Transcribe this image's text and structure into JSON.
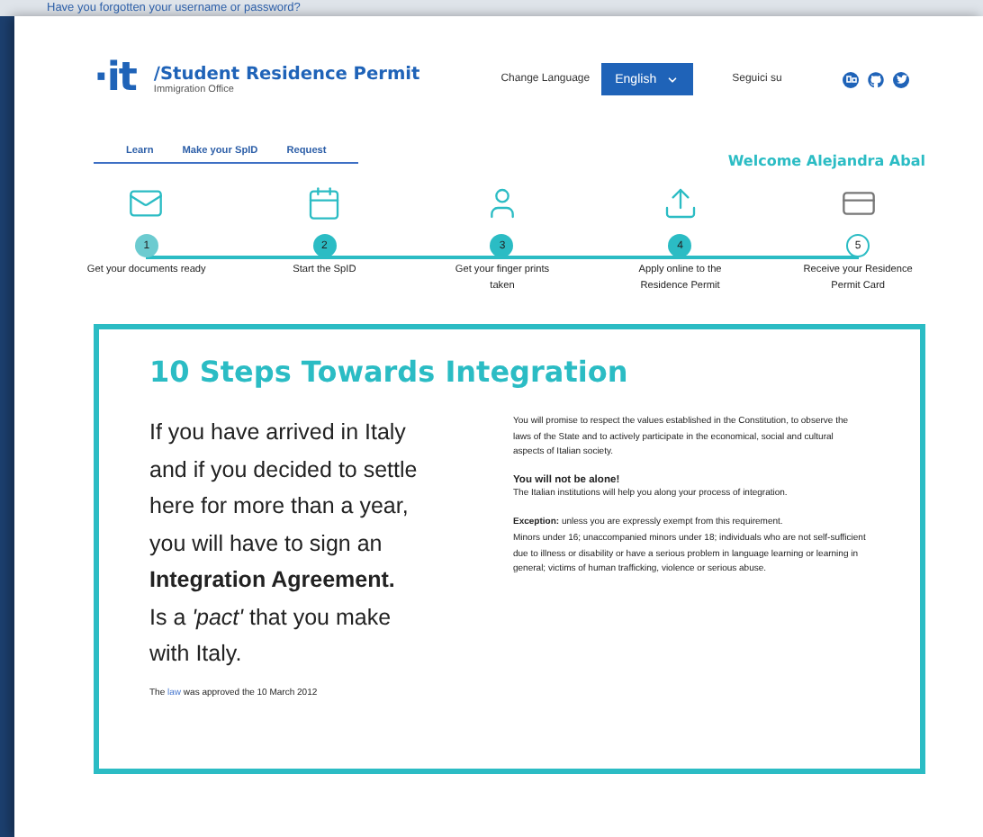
{
  "backdrop": {
    "forgot_link": "Have you forgotten your username or password?"
  },
  "header": {
    "logo": "·it",
    "title": "/Student Residence Permit",
    "subtitle": "Immigration Office",
    "language_label": "Change Language",
    "language": "English",
    "follow_label": "Seguici su"
  },
  "nav": {
    "tabs": [
      {
        "label": "Learn"
      },
      {
        "label": "Make your SpID"
      },
      {
        "label": "Request"
      }
    ],
    "welcome": "Welcome Alejandra Abal"
  },
  "steps": [
    {
      "number": "1",
      "label": "Get your documents ready",
      "kind": "pale"
    },
    {
      "number": "2",
      "label": "Start the SpID",
      "kind": "filled"
    },
    {
      "number": "3",
      "label": "Get your finger prints taken",
      "kind": "filled"
    },
    {
      "number": "4",
      "label": "Apply online to the Residence Permit",
      "kind": "filled"
    },
    {
      "number": "5",
      "label": "Receive your Residence Permit Card",
      "kind": "outline"
    }
  ],
  "info": {
    "title": "10 Steps Towards Integration",
    "lead_lines": [
      "If you have arrived in Italy",
      "and if you decided to settle",
      "here for more than a year,",
      "you will have to sign an",
      "**Integration Agreement.**",
      "Is a *'pact'* that you make",
      "with Italy."
    ],
    "note": {
      "before": "The",
      "link": "law",
      "after": "was approved the 10 March 2012"
    },
    "paragraph_1": "You will promise to respect the values established in the Constitution, to observe the laws of the State and to actively participate in the economical, social and cultural aspects of Italian society.",
    "subheading": "You will not be alone!",
    "paragraph_2": "The Italian institutions will help you along your process of integration.",
    "paragraph_3": "**Exception:** unless you are expressly exempt from this requirement.",
    "paragraph_4": "Minors under 16; unaccompanied minors under 18; individuals who are not self-sufficient due to illness or disability or have a serious problem in language learning or learning in general; victims of human trafficking, violence or serious abuse."
  }
}
